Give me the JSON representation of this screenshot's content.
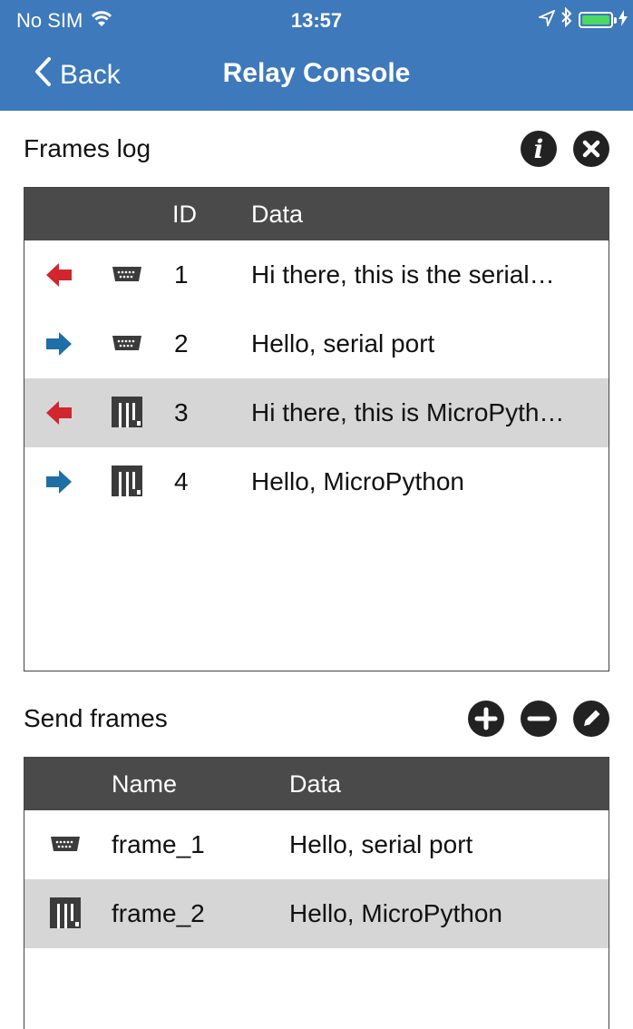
{
  "status_bar": {
    "carrier": "No SIM",
    "time": "13:57"
  },
  "nav": {
    "back_label": "Back",
    "title": "Relay Console"
  },
  "frames_log": {
    "title": "Frames log",
    "columns": {
      "id": "ID",
      "data": "Data"
    },
    "rows": [
      {
        "direction": "in",
        "source": "serial-port-icon",
        "id": "1",
        "data": "Hi there, this is the serial…"
      },
      {
        "direction": "out",
        "source": "serial-port-icon",
        "id": "2",
        "data": "Hello, serial port"
      },
      {
        "direction": "in",
        "source": "micropython-icon",
        "id": "3",
        "data": "Hi there, this is MicroPyth…"
      },
      {
        "direction": "out",
        "source": "micropython-icon",
        "id": "4",
        "data": "Hello, MicroPython"
      }
    ],
    "selected_row": 3
  },
  "send_frames": {
    "title": "Send frames",
    "columns": {
      "name": "Name",
      "data": "Data"
    },
    "rows": [
      {
        "source": "serial-port-icon",
        "name": "frame_1",
        "data": "Hello, serial port"
      },
      {
        "source": "micropython-icon",
        "name": "frame_2",
        "data": "Hello, MicroPython"
      }
    ],
    "selected_row": 2
  },
  "colors": {
    "nav_bar": "#3d79bb",
    "incoming_arrow": "#d0262e",
    "outgoing_arrow": "#1d6fa6",
    "table_header": "#4a4a4a",
    "selected_row": "#d6d6d6"
  }
}
